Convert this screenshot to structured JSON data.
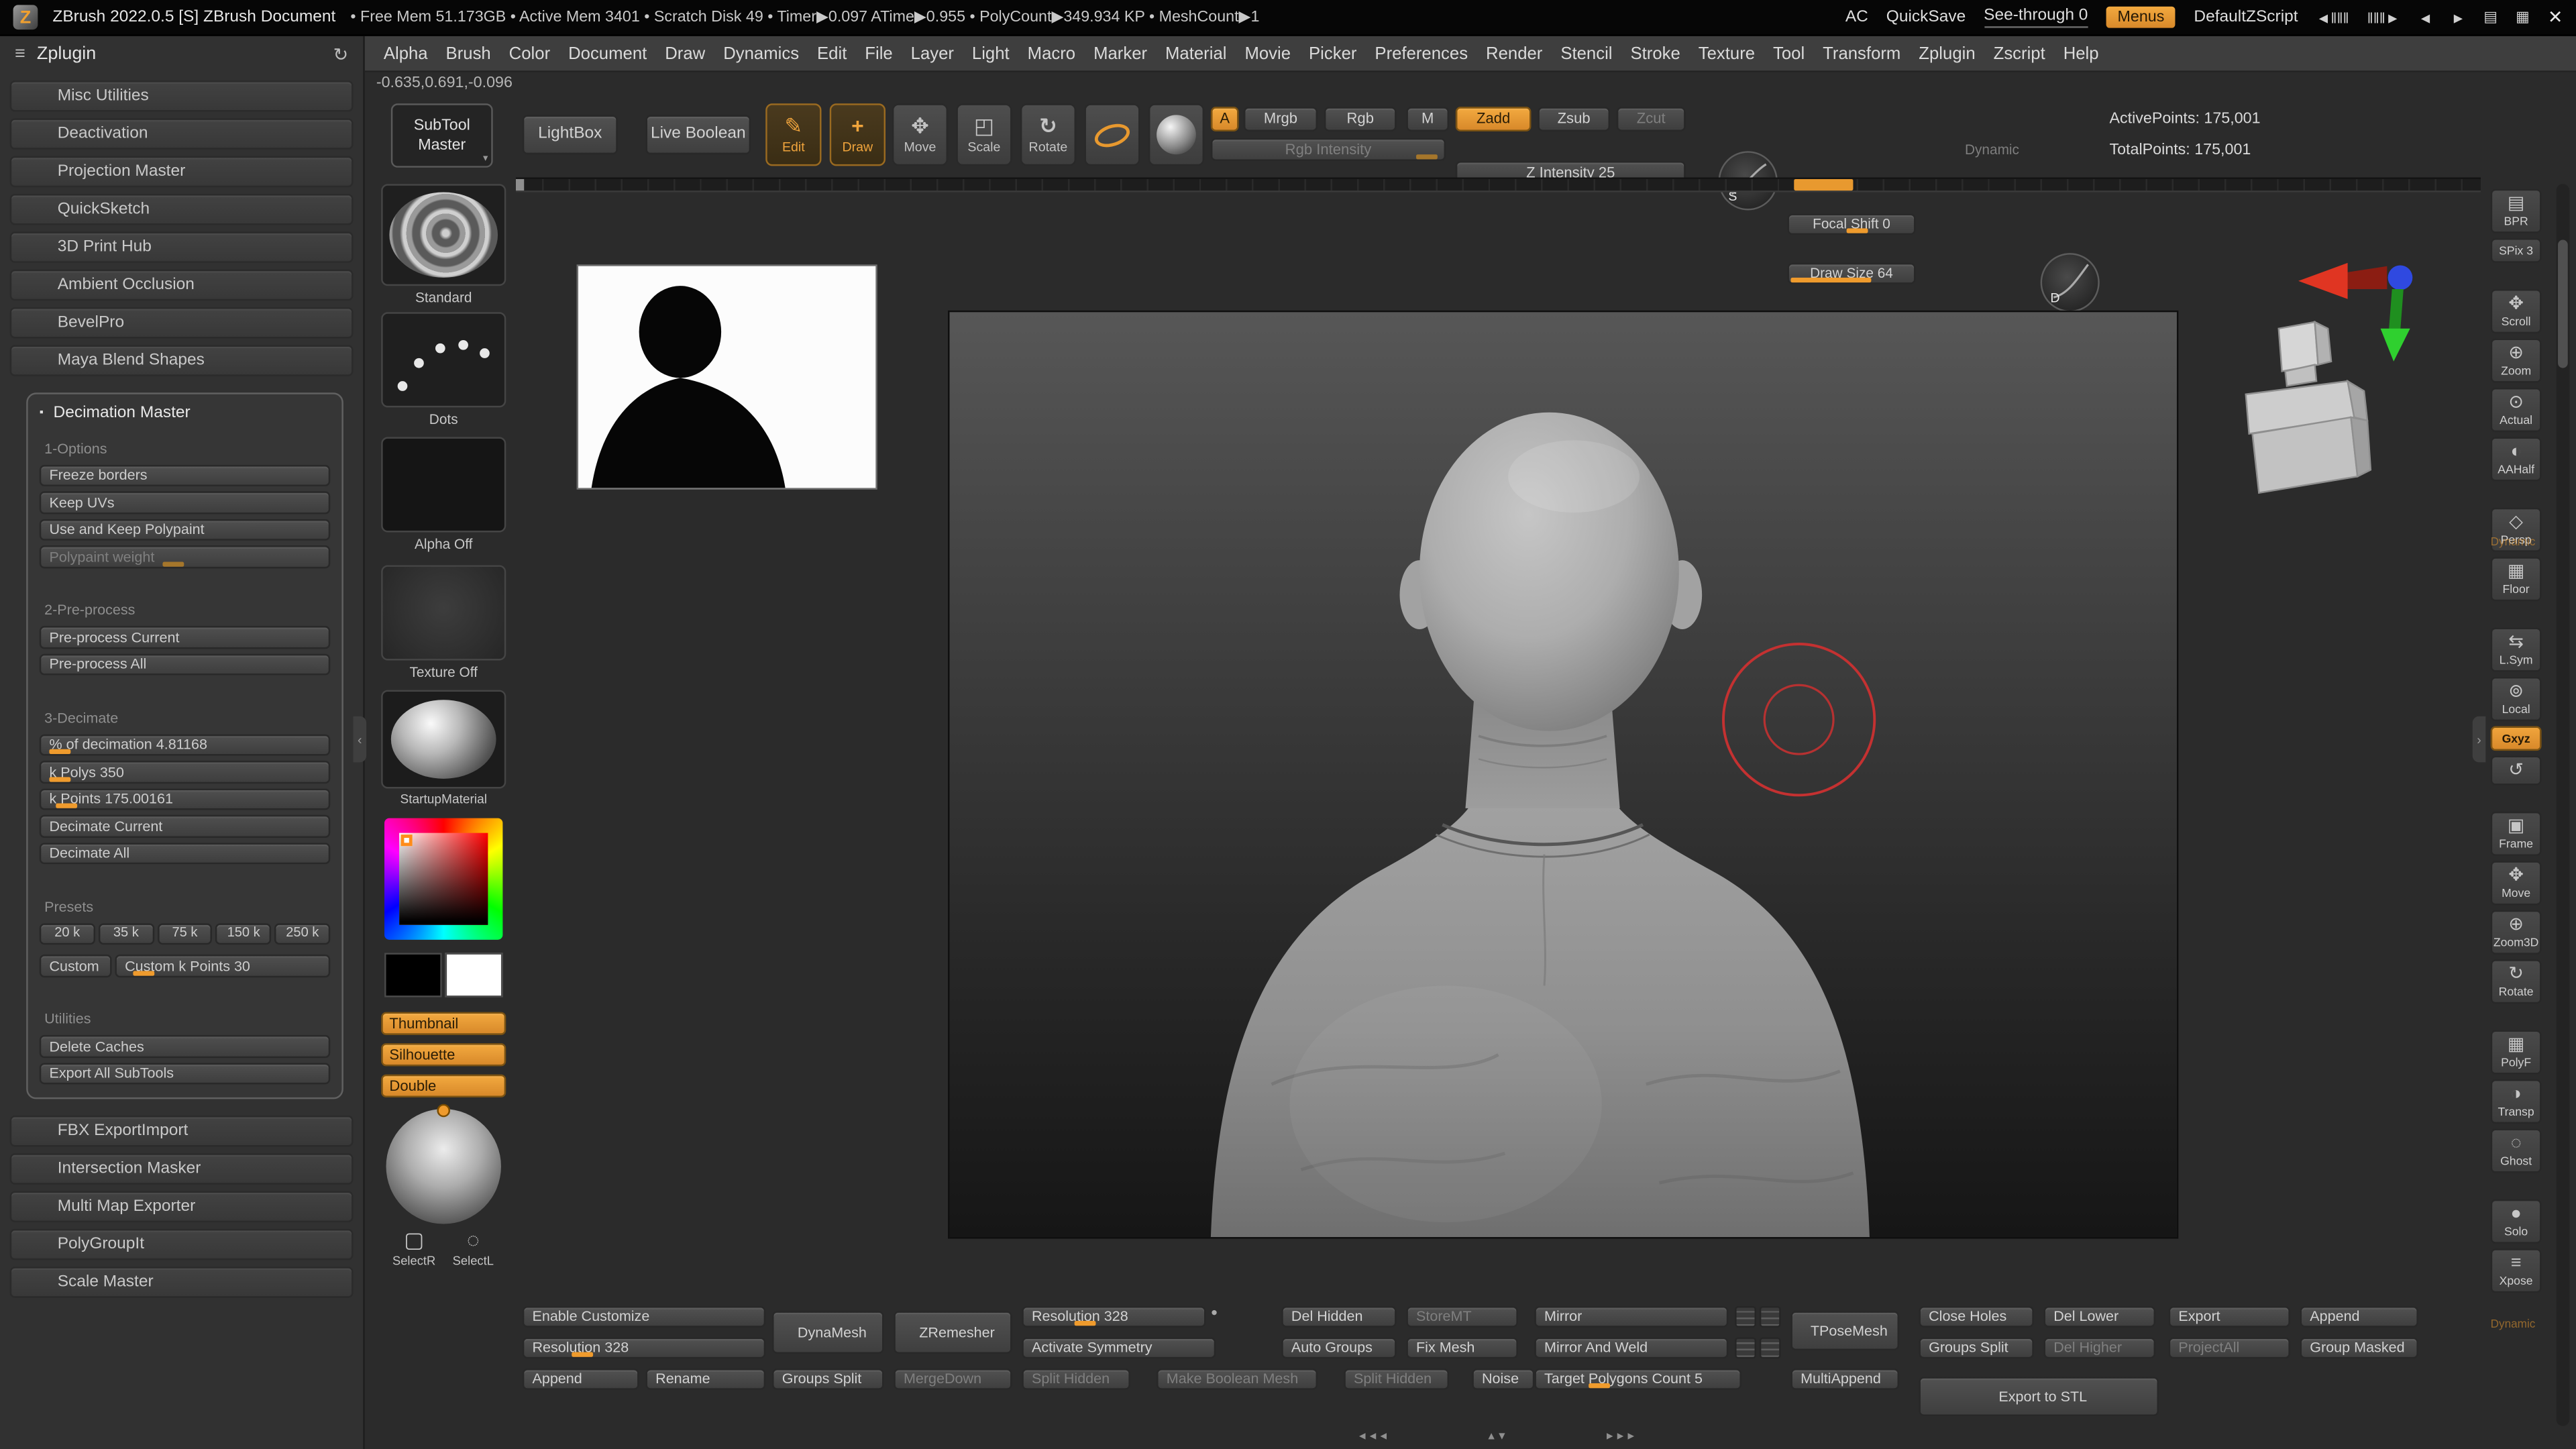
{
  "titlebar": {
    "logo": "Z",
    "app_title": "ZBrush 2022.0.5 [S]  ZBrush Document",
    "stats": "• Free Mem 51.173GB • Active Mem 3401 • Scratch Disk 49 • Timer▶0.097 ATime▶0.955 • PolyCount▶349.934 KP • MeshCount▶1",
    "ac": "AC",
    "quicksave": "QuickSave",
    "see_through": "See-through 0",
    "menus": "Menus",
    "zscript_name": "DefaultZScript",
    "icons": {
      "scrub_back": "◄‖‖‖",
      "scrub_fwd": "‖‖‖►",
      "prev": "◄",
      "next": "►",
      "print": "▤",
      "panel": "▦",
      "close": "✕"
    }
  },
  "menubar": {
    "items": [
      "Alpha",
      "Brush",
      "Color",
      "Document",
      "Draw",
      "Dynamics",
      "Edit",
      "File",
      "Layer",
      "Light",
      "Macro",
      "Marker",
      "Material",
      "Movie",
      "Picker",
      "Preferences",
      "Render",
      "Stencil",
      "Stroke",
      "Texture",
      "Tool",
      "Transform",
      "Zplugin",
      "Zscript",
      "Help"
    ]
  },
  "coords": "-0.635,0.691,-0.096",
  "zplugin": {
    "title": "Zplugin",
    "icons": {
      "menu": "≡",
      "refresh": "↻"
    },
    "items_top": [
      "Misc Utilities",
      "Deactivation",
      "Projection Master",
      "QuickSketch",
      "3D Print Hub",
      "Ambient Occlusion",
      "BevelPro",
      "Maya Blend Shapes"
    ],
    "decimation": {
      "bullet": "▪",
      "title": "Decimation Master",
      "rows": [
        {
          "type": "label",
          "text": "1-Options"
        },
        {
          "type": "button",
          "text": "Freeze borders"
        },
        {
          "type": "button",
          "text": "Keep UVs"
        },
        {
          "type": "button",
          "text": "Use and Keep Polypaint"
        },
        {
          "type": "slider dis",
          "text": "Polypaint weight",
          "tick": "42%"
        },
        {
          "type": "label gapbig",
          "text": "2-Pre-process"
        },
        {
          "type": "button",
          "text": "Pre-process Current"
        },
        {
          "type": "button",
          "text": "Pre-process All"
        },
        {
          "type": "label gapbig",
          "text": "3-Decimate"
        },
        {
          "type": "slider",
          "text": "% of decimation 4.81168",
          "tick": "3%"
        },
        {
          "type": "slider",
          "text": "k Polys 350",
          "tick": "3%"
        },
        {
          "type": "slider",
          "text": "k Points 175.00161",
          "tick": "5%"
        },
        {
          "type": "button",
          "text": "Decimate Current"
        },
        {
          "type": "button",
          "text": "Decimate All"
        }
      ],
      "presets_label": "Presets",
      "presets": [
        "20 k",
        "35 k",
        "75 k",
        "150 k",
        "250 k"
      ],
      "custom": "Custom",
      "custom_k": "Custom k Points 30",
      "utilities_label": "Utilities",
      "utility_rows": [
        "Delete Caches",
        "Export All SubTools"
      ]
    },
    "items_bottom": [
      "FBX ExportImport",
      "Intersection Masker",
      "Multi Map Exporter",
      "PolyGroupIt",
      "Scale Master"
    ]
  },
  "shelf": {
    "subtool_master": "SubTool Master",
    "caret": "▾",
    "lightbox": "LightBox",
    "live_boolean": "Live Boolean",
    "tools": {
      "edit": "Edit",
      "draw": "Draw",
      "move": "Move",
      "scale": "Scale",
      "rotate": "Rotate"
    },
    "tool_icons": {
      "edit": "✎",
      "draw": "+",
      "move": "✥",
      "scale": "◰",
      "rotate": "↻"
    },
    "a_toggle": "A",
    "mrgb": "Mrgb",
    "rgb": "Rgb",
    "m": "M",
    "zadd": "Zadd",
    "zsub": "Zsub",
    "zcut": "Zcut",
    "rgb_intensity": "Rgb Intensity",
    "z_intensity": "Z Intensity 25",
    "s_badge": "S",
    "focal_shift": "Focal Shift 0",
    "draw_size": "Draw Size 64",
    "dynamic": "Dynamic",
    "d_badge": "D",
    "active_points": "ActivePoints: 175,001",
    "total_points": "TotalPoints: 175,001"
  },
  "tray": {
    "brush_name": "Standard",
    "stroke_name": "Dots",
    "alpha_name": "Alpha Off",
    "texture_name": "Texture Off",
    "material_name": "StartupMaterial",
    "thumbnail": "Thumbnail",
    "silhouette": "Silhouette",
    "double": "Double",
    "selectr": "SelectR",
    "selectl": "SelectL",
    "selectr_icon": "▢",
    "selectl_icon": "◌"
  },
  "right_shelf": {
    "dynamic_label": "Dynamic",
    "items": [
      {
        "label": "BPR",
        "icon": "▤"
      },
      {
        "label": "SPix 3",
        "icon": ""
      },
      {
        "label": "Scroll",
        "icon": "✥",
        "type": "gap"
      },
      {
        "label": "Zoom",
        "icon": "⊕"
      },
      {
        "label": "Actual",
        "icon": "⊙"
      },
      {
        "label": "AAHalf",
        "icon": "◐"
      },
      {
        "label": "Persp",
        "icon": "◇",
        "type": "gap"
      },
      {
        "label": "Floor",
        "icon": "▦"
      },
      {
        "label": "L.Sym",
        "icon": "⇆",
        "type": "gap"
      },
      {
        "label": "Local",
        "icon": "⊚"
      },
      {
        "label": "Gxyz",
        "icon": "",
        "type": "active"
      },
      {
        "label": "",
        "icon": "↺"
      },
      {
        "label": "Frame",
        "icon": "▣",
        "type": "gap"
      },
      {
        "label": "Move",
        "icon": "✥"
      },
      {
        "label": "Zoom3D",
        "icon": "⊕"
      },
      {
        "label": "Rotate",
        "icon": "↻"
      },
      {
        "label": "PolyF",
        "icon": "▦",
        "type": "gap"
      },
      {
        "label": "Transp",
        "icon": "◑"
      },
      {
        "label": "Ghost",
        "icon": "◌"
      },
      {
        "label": "Solo",
        "icon": "●",
        "type": "gap"
      },
      {
        "label": "Xpose",
        "icon": "≡"
      }
    ]
  },
  "bottom": {
    "enable_customize": "Enable Customize",
    "resolution_left": "Resolution 328",
    "append_left": "Append",
    "rename": "Rename",
    "dynamesh": "DynaMesh",
    "groups_split_a": "Groups Split",
    "zremesher": "ZRemesher",
    "mergedown": "MergeDown",
    "resolution_right": "Resolution 328",
    "res_dot": "●",
    "activate_symmetry": "Activate Symmetry",
    "split_hidden_a": "Split Hidden",
    "make_boolean_mesh": "Make Boolean Mesh",
    "split_hidden_b": "Split Hidden",
    "noise": "Noise",
    "del_hidden": "Del Hidden",
    "storemt": "StoreMT",
    "auto_groups": "Auto Groups",
    "fix_mesh": "Fix Mesh",
    "mirror": "Mirror",
    "mirror_and_weld": "Mirror And Weld",
    "target_polygons": "Target Polygons Count 5",
    "tposemesh": "TPoseMesh",
    "multiappend": "MultiAppend",
    "close_holes": "Close Holes",
    "groups_split_b": "Groups Split",
    "export_stl": "Export to STL",
    "del_lower": "Del Lower",
    "del_higher": "Del Higher",
    "export": "Export",
    "projectall": "ProjectAll",
    "append_right": "Append",
    "group_masked": "Group Masked"
  },
  "scrubber": {
    "left": "◄◄◄",
    "mid": "▲▼",
    "right": "►►►"
  },
  "handles": {
    "left": "‹",
    "right": "›"
  },
  "colors": {
    "accent": "#e8992f",
    "cursor": "#c43131",
    "canvas_top": "#575757",
    "canvas_bottom": "#161616"
  }
}
